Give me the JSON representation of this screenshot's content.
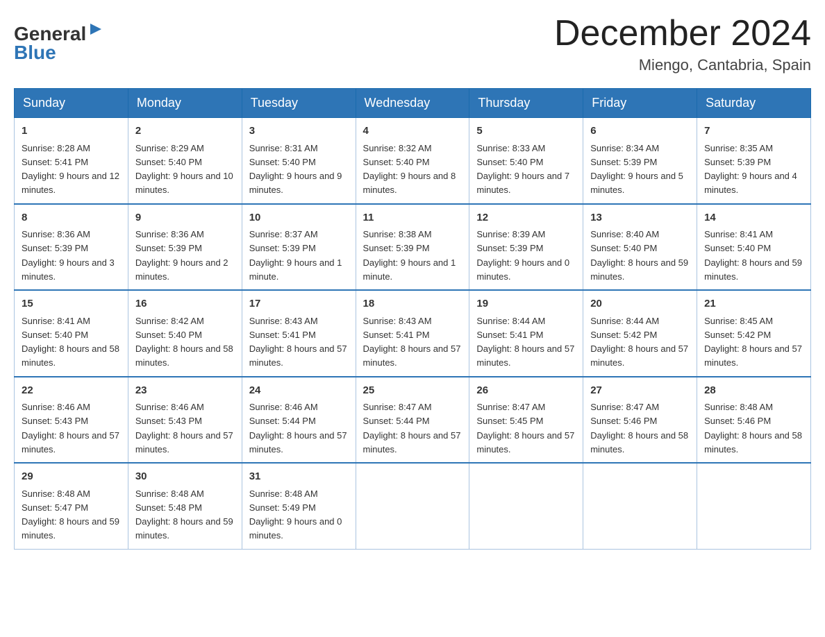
{
  "header": {
    "logo_general": "General",
    "logo_blue": "Blue",
    "month_title": "December 2024",
    "location": "Miengo, Cantabria, Spain"
  },
  "days_of_week": [
    "Sunday",
    "Monday",
    "Tuesday",
    "Wednesday",
    "Thursday",
    "Friday",
    "Saturday"
  ],
  "weeks": [
    [
      {
        "num": "1",
        "sunrise": "8:28 AM",
        "sunset": "5:41 PM",
        "daylight": "9 hours and 12 minutes."
      },
      {
        "num": "2",
        "sunrise": "8:29 AM",
        "sunset": "5:40 PM",
        "daylight": "9 hours and 10 minutes."
      },
      {
        "num": "3",
        "sunrise": "8:31 AM",
        "sunset": "5:40 PM",
        "daylight": "9 hours and 9 minutes."
      },
      {
        "num": "4",
        "sunrise": "8:32 AM",
        "sunset": "5:40 PM",
        "daylight": "9 hours and 8 minutes."
      },
      {
        "num": "5",
        "sunrise": "8:33 AM",
        "sunset": "5:40 PM",
        "daylight": "9 hours and 7 minutes."
      },
      {
        "num": "6",
        "sunrise": "8:34 AM",
        "sunset": "5:39 PM",
        "daylight": "9 hours and 5 minutes."
      },
      {
        "num": "7",
        "sunrise": "8:35 AM",
        "sunset": "5:39 PM",
        "daylight": "9 hours and 4 minutes."
      }
    ],
    [
      {
        "num": "8",
        "sunrise": "8:36 AM",
        "sunset": "5:39 PM",
        "daylight": "9 hours and 3 minutes."
      },
      {
        "num": "9",
        "sunrise": "8:36 AM",
        "sunset": "5:39 PM",
        "daylight": "9 hours and 2 minutes."
      },
      {
        "num": "10",
        "sunrise": "8:37 AM",
        "sunset": "5:39 PM",
        "daylight": "9 hours and 1 minute."
      },
      {
        "num": "11",
        "sunrise": "8:38 AM",
        "sunset": "5:39 PM",
        "daylight": "9 hours and 1 minute."
      },
      {
        "num": "12",
        "sunrise": "8:39 AM",
        "sunset": "5:39 PM",
        "daylight": "9 hours and 0 minutes."
      },
      {
        "num": "13",
        "sunrise": "8:40 AM",
        "sunset": "5:40 PM",
        "daylight": "8 hours and 59 minutes."
      },
      {
        "num": "14",
        "sunrise": "8:41 AM",
        "sunset": "5:40 PM",
        "daylight": "8 hours and 59 minutes."
      }
    ],
    [
      {
        "num": "15",
        "sunrise": "8:41 AM",
        "sunset": "5:40 PM",
        "daylight": "8 hours and 58 minutes."
      },
      {
        "num": "16",
        "sunrise": "8:42 AM",
        "sunset": "5:40 PM",
        "daylight": "8 hours and 58 minutes."
      },
      {
        "num": "17",
        "sunrise": "8:43 AM",
        "sunset": "5:41 PM",
        "daylight": "8 hours and 57 minutes."
      },
      {
        "num": "18",
        "sunrise": "8:43 AM",
        "sunset": "5:41 PM",
        "daylight": "8 hours and 57 minutes."
      },
      {
        "num": "19",
        "sunrise": "8:44 AM",
        "sunset": "5:41 PM",
        "daylight": "8 hours and 57 minutes."
      },
      {
        "num": "20",
        "sunrise": "8:44 AM",
        "sunset": "5:42 PM",
        "daylight": "8 hours and 57 minutes."
      },
      {
        "num": "21",
        "sunrise": "8:45 AM",
        "sunset": "5:42 PM",
        "daylight": "8 hours and 57 minutes."
      }
    ],
    [
      {
        "num": "22",
        "sunrise": "8:46 AM",
        "sunset": "5:43 PM",
        "daylight": "8 hours and 57 minutes."
      },
      {
        "num": "23",
        "sunrise": "8:46 AM",
        "sunset": "5:43 PM",
        "daylight": "8 hours and 57 minutes."
      },
      {
        "num": "24",
        "sunrise": "8:46 AM",
        "sunset": "5:44 PM",
        "daylight": "8 hours and 57 minutes."
      },
      {
        "num": "25",
        "sunrise": "8:47 AM",
        "sunset": "5:44 PM",
        "daylight": "8 hours and 57 minutes."
      },
      {
        "num": "26",
        "sunrise": "8:47 AM",
        "sunset": "5:45 PM",
        "daylight": "8 hours and 57 minutes."
      },
      {
        "num": "27",
        "sunrise": "8:47 AM",
        "sunset": "5:46 PM",
        "daylight": "8 hours and 58 minutes."
      },
      {
        "num": "28",
        "sunrise": "8:48 AM",
        "sunset": "5:46 PM",
        "daylight": "8 hours and 58 minutes."
      }
    ],
    [
      {
        "num": "29",
        "sunrise": "8:48 AM",
        "sunset": "5:47 PM",
        "daylight": "8 hours and 59 minutes."
      },
      {
        "num": "30",
        "sunrise": "8:48 AM",
        "sunset": "5:48 PM",
        "daylight": "8 hours and 59 minutes."
      },
      {
        "num": "31",
        "sunrise": "8:48 AM",
        "sunset": "5:49 PM",
        "daylight": "9 hours and 0 minutes."
      },
      null,
      null,
      null,
      null
    ]
  ]
}
